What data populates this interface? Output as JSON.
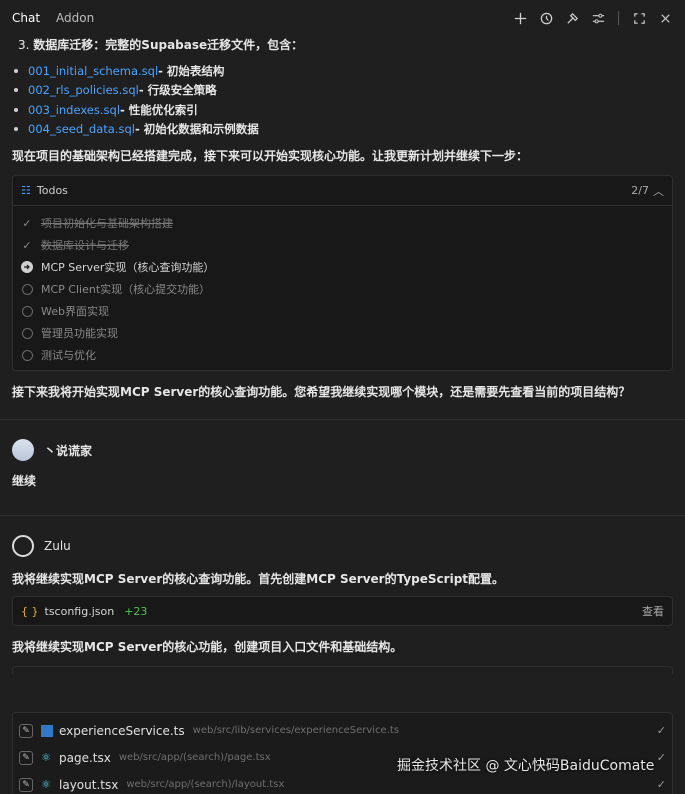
{
  "tabs": [
    {
      "label": "Chat"
    },
    {
      "label": "Addon"
    }
  ],
  "migration": {
    "number": "3.",
    "title": "数据库迁移",
    "desc": "：完整的Supabase迁移文件，包含：",
    "files": [
      {
        "name": "001_initial_schema.sql",
        "desc": " - 初始表结构"
      },
      {
        "name": "002_rls_policies.sql",
        "desc": " - 行级安全策略"
      },
      {
        "name": "003_indexes.sql",
        "desc": " - 性能优化索引"
      },
      {
        "name": "004_seed_data.sql",
        "desc": " - 初始化数据和示例数据"
      }
    ],
    "summary": "现在项目的基础架构已经搭建完成，接下来可以开始实现核心功能。让我更新计划并继续下一步："
  },
  "todos": {
    "title": "Todos",
    "count": "2/7",
    "items": [
      {
        "text": "项目初始化与基础架构搭建",
        "status": "done"
      },
      {
        "text": "数据库设计与迁移",
        "status": "done"
      },
      {
        "text": "MCP Server实现（核心查询功能）",
        "status": "current"
      },
      {
        "text": "MCP Client实现（核心提交功能）",
        "status": "pending"
      },
      {
        "text": "Web界面实现",
        "status": "pending"
      },
      {
        "text": "管理员功能实现",
        "status": "pending"
      },
      {
        "text": "测试与优化",
        "status": "pending"
      }
    ]
  },
  "question": "接下来我将开始实现MCP Server的核心查询功能。您希望我继续实现哪个模块，还是需要先查看当前的项目结构？",
  "user": {
    "name": "丶说谎家",
    "message": "继续"
  },
  "bot": {
    "name": "Zulu",
    "msg1": "我将继续实现MCP Server的核心查询功能。首先创建MCP Server的TypeScript配置。",
    "file": {
      "name": "tsconfig.json",
      "diff": "+23",
      "action": "查看"
    },
    "msg2": "我将继续实现MCP Server的核心功能，创建项目入口文件和基础结构。"
  },
  "edits": [
    {
      "name": "experienceService.ts",
      "path": "web/src/lib/services/experienceService.ts",
      "icon": "ts-file-icon"
    },
    {
      "name": "page.tsx",
      "path": "web/src/app/(search)/page.tsx",
      "icon": "react-file-icon"
    },
    {
      "name": "layout.tsx",
      "path": "web/src/app/(search)/layout.tsx",
      "icon": "react-file-icon"
    }
  ],
  "watermark": "掘金技术社区 @ 文心快码BaiduComate",
  "colors": {
    "link": "#4aa3ff",
    "diff": "#57c057",
    "bg": "#1f1f1f"
  }
}
